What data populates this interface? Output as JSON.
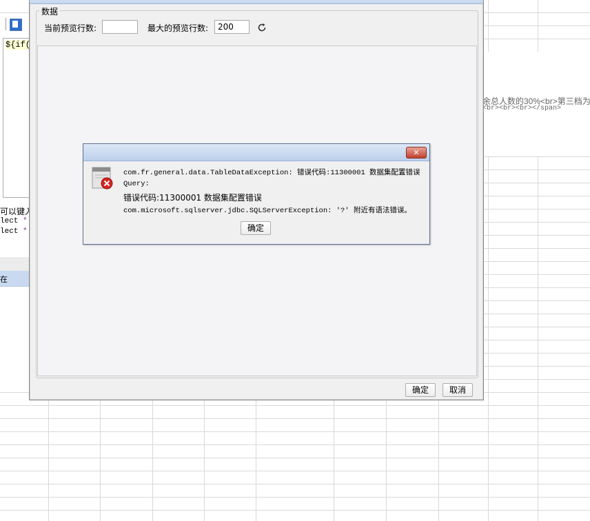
{
  "spreadsheet": {
    "cell_text_1": "余总人数的30%<br>第三档为",
    "cell_text_2": "<br><br><br></span>"
  },
  "editor": {
    "code_line": "${if(",
    "hint_fragment": "可以键入",
    "sql_line_1_prefix": "lect ",
    "sql_line_1_star": "*",
    "sql_line_2_prefix": "lect ",
    "sql_line_2_star": "*",
    "panel_fragment": "在"
  },
  "data_dialog": {
    "group_title": "数据",
    "current_preview_rows_label": "当前预览行数:",
    "current_preview_rows_value": "",
    "max_preview_rows_label": "最大的预览行数:",
    "max_preview_rows_value": "200",
    "refresh_icon": "refresh-icon",
    "ok_button": "确定",
    "cancel_button": "取消"
  },
  "error_dialog": {
    "close_symbol": "✕",
    "icon": "error-icon",
    "line1": "com.fr.general.data.TableDataException: 错误代码:11300001 数据集配置错误",
    "line2": "Query:",
    "line3": "错误代码:11300001 数据集配置错误",
    "line4": "com.microsoft.sqlserver.jdbc.SQLServerException: '?' 附近有语法错误。",
    "ok_button": "确定",
    "accent_color": "#c0412f"
  }
}
